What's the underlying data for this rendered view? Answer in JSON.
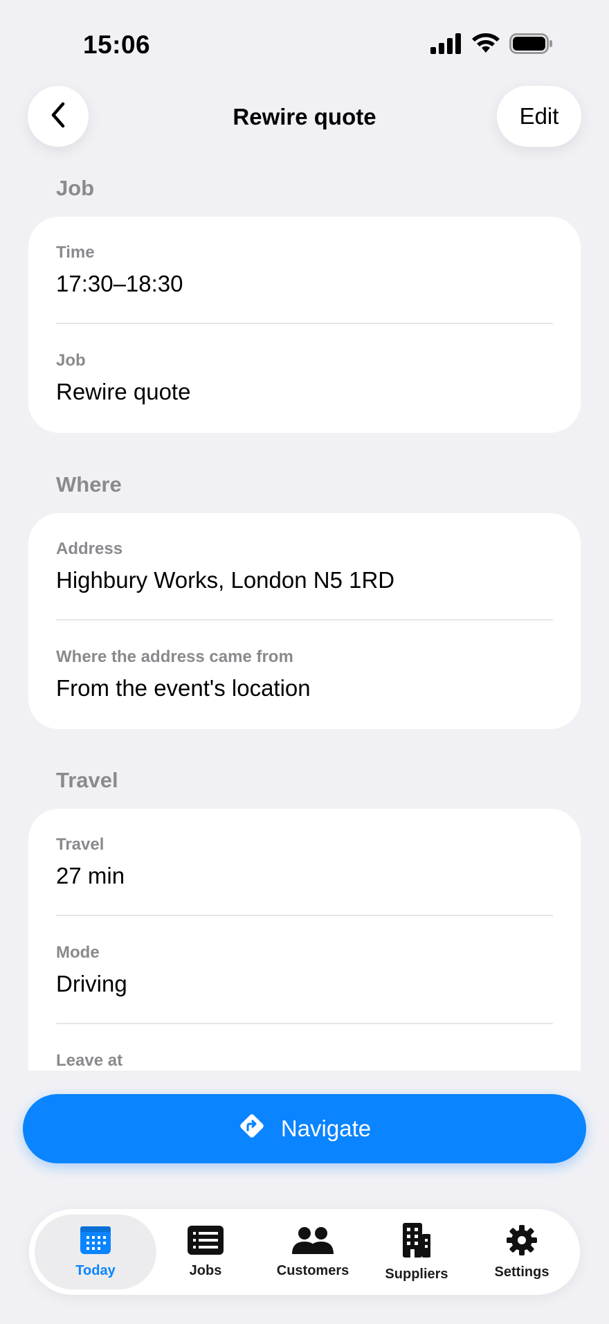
{
  "status_bar": {
    "time": "15:06"
  },
  "nav": {
    "title": "Rewire quote",
    "edit_label": "Edit"
  },
  "sections": {
    "job": {
      "header": "Job",
      "rows": [
        {
          "label": "Time",
          "value": "17:30–18:30"
        },
        {
          "label": "Job",
          "value": "Rewire quote"
        }
      ]
    },
    "where": {
      "header": "Where",
      "rows": [
        {
          "label": "Address",
          "value": "Highbury Works, London N5 1RD"
        },
        {
          "label": "Where the address came from",
          "value": "From the event's location"
        }
      ]
    },
    "travel": {
      "header": "Travel",
      "rows": [
        {
          "label": "Travel",
          "value": "27 min"
        },
        {
          "label": "Mode",
          "value": "Driving"
        },
        {
          "label": "Leave at",
          "value": ""
        }
      ]
    }
  },
  "navigate_button": {
    "label": "Navigate"
  },
  "tab_bar": {
    "tabs": [
      {
        "label": "Today",
        "icon": "calendar-icon",
        "active": true
      },
      {
        "label": "Jobs",
        "icon": "list-icon",
        "active": false
      },
      {
        "label": "Customers",
        "icon": "people-icon",
        "active": false
      },
      {
        "label": "Suppliers",
        "icon": "building-icon",
        "active": false
      },
      {
        "label": "Settings",
        "icon": "gear-icon",
        "active": false
      }
    ]
  },
  "colors": {
    "accent": "#0a84ff",
    "background": "#f1f1f5",
    "secondary_text": "#8a8a8e"
  }
}
